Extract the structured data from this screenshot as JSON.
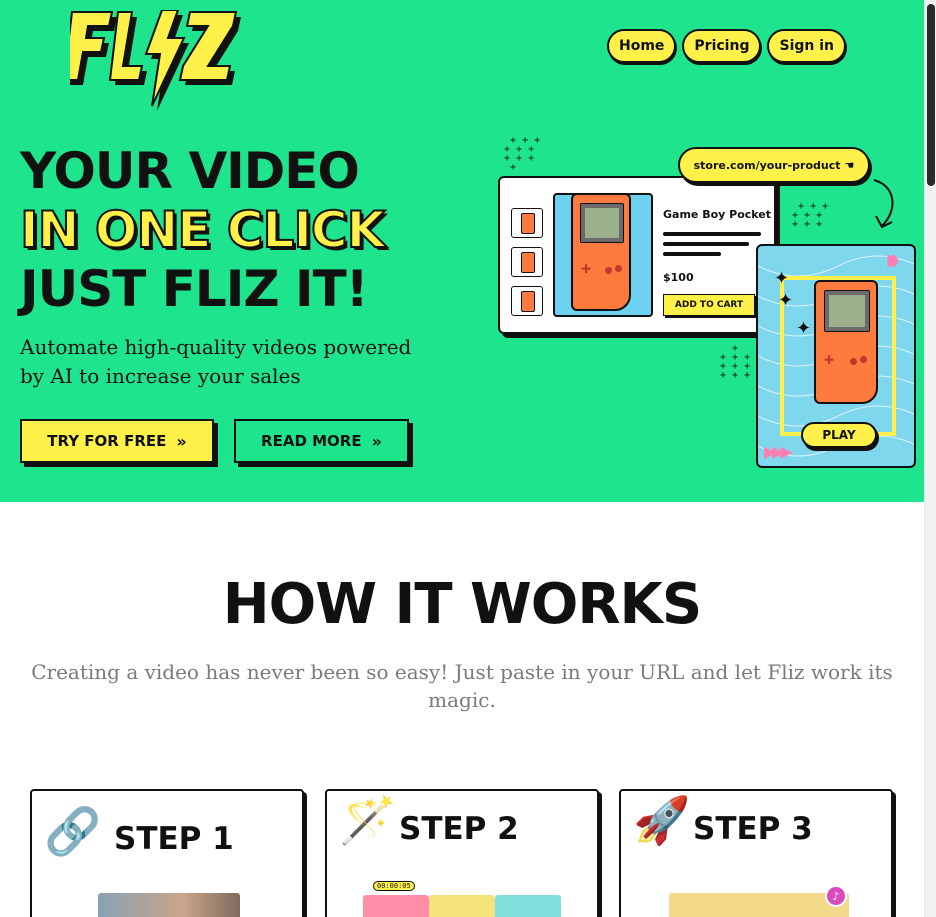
{
  "brand": {
    "logo_text": "FLIZ",
    "color_primary": "#1ee58d",
    "color_accent": "#fff14a",
    "color_ink": "#111111"
  },
  "nav": {
    "items": [
      {
        "label": "Home"
      },
      {
        "label": "Pricing"
      },
      {
        "label": "Sign in"
      }
    ]
  },
  "hero": {
    "headline_lines": [
      "YOUR VIDEO",
      "IN ONE CLICK",
      "JUST FLIZ IT!"
    ],
    "subhead": "Automate high-quality videos powered by AI to increase your sales",
    "cta_primary": "TRY FOR FREE",
    "cta_secondary": "READ MORE",
    "cta_icon": "double-chevron-right-icon"
  },
  "illustration": {
    "url_pill": "store.com/your-product",
    "url_icon": "pointer-hand-icon",
    "product_title": "Game Boy Pocket",
    "product_price": "$100",
    "add_to_cart": "ADD TO CART",
    "play_label": "PLAY"
  },
  "how_it_works": {
    "title": "HOW IT WORKS",
    "subtitle": "Creating a video has never been so easy! Just paste in your URL and let Fliz work its magic.",
    "steps": [
      {
        "label": "STEP 1",
        "icon": "link-icon",
        "emoji": "🔗"
      },
      {
        "label": "STEP 2",
        "icon": "magic-wand-icon",
        "emoji": "🪄"
      },
      {
        "label": "STEP 3",
        "icon": "rocket-icon",
        "emoji": "🚀"
      }
    ],
    "step2_timer": "00:00:05"
  }
}
